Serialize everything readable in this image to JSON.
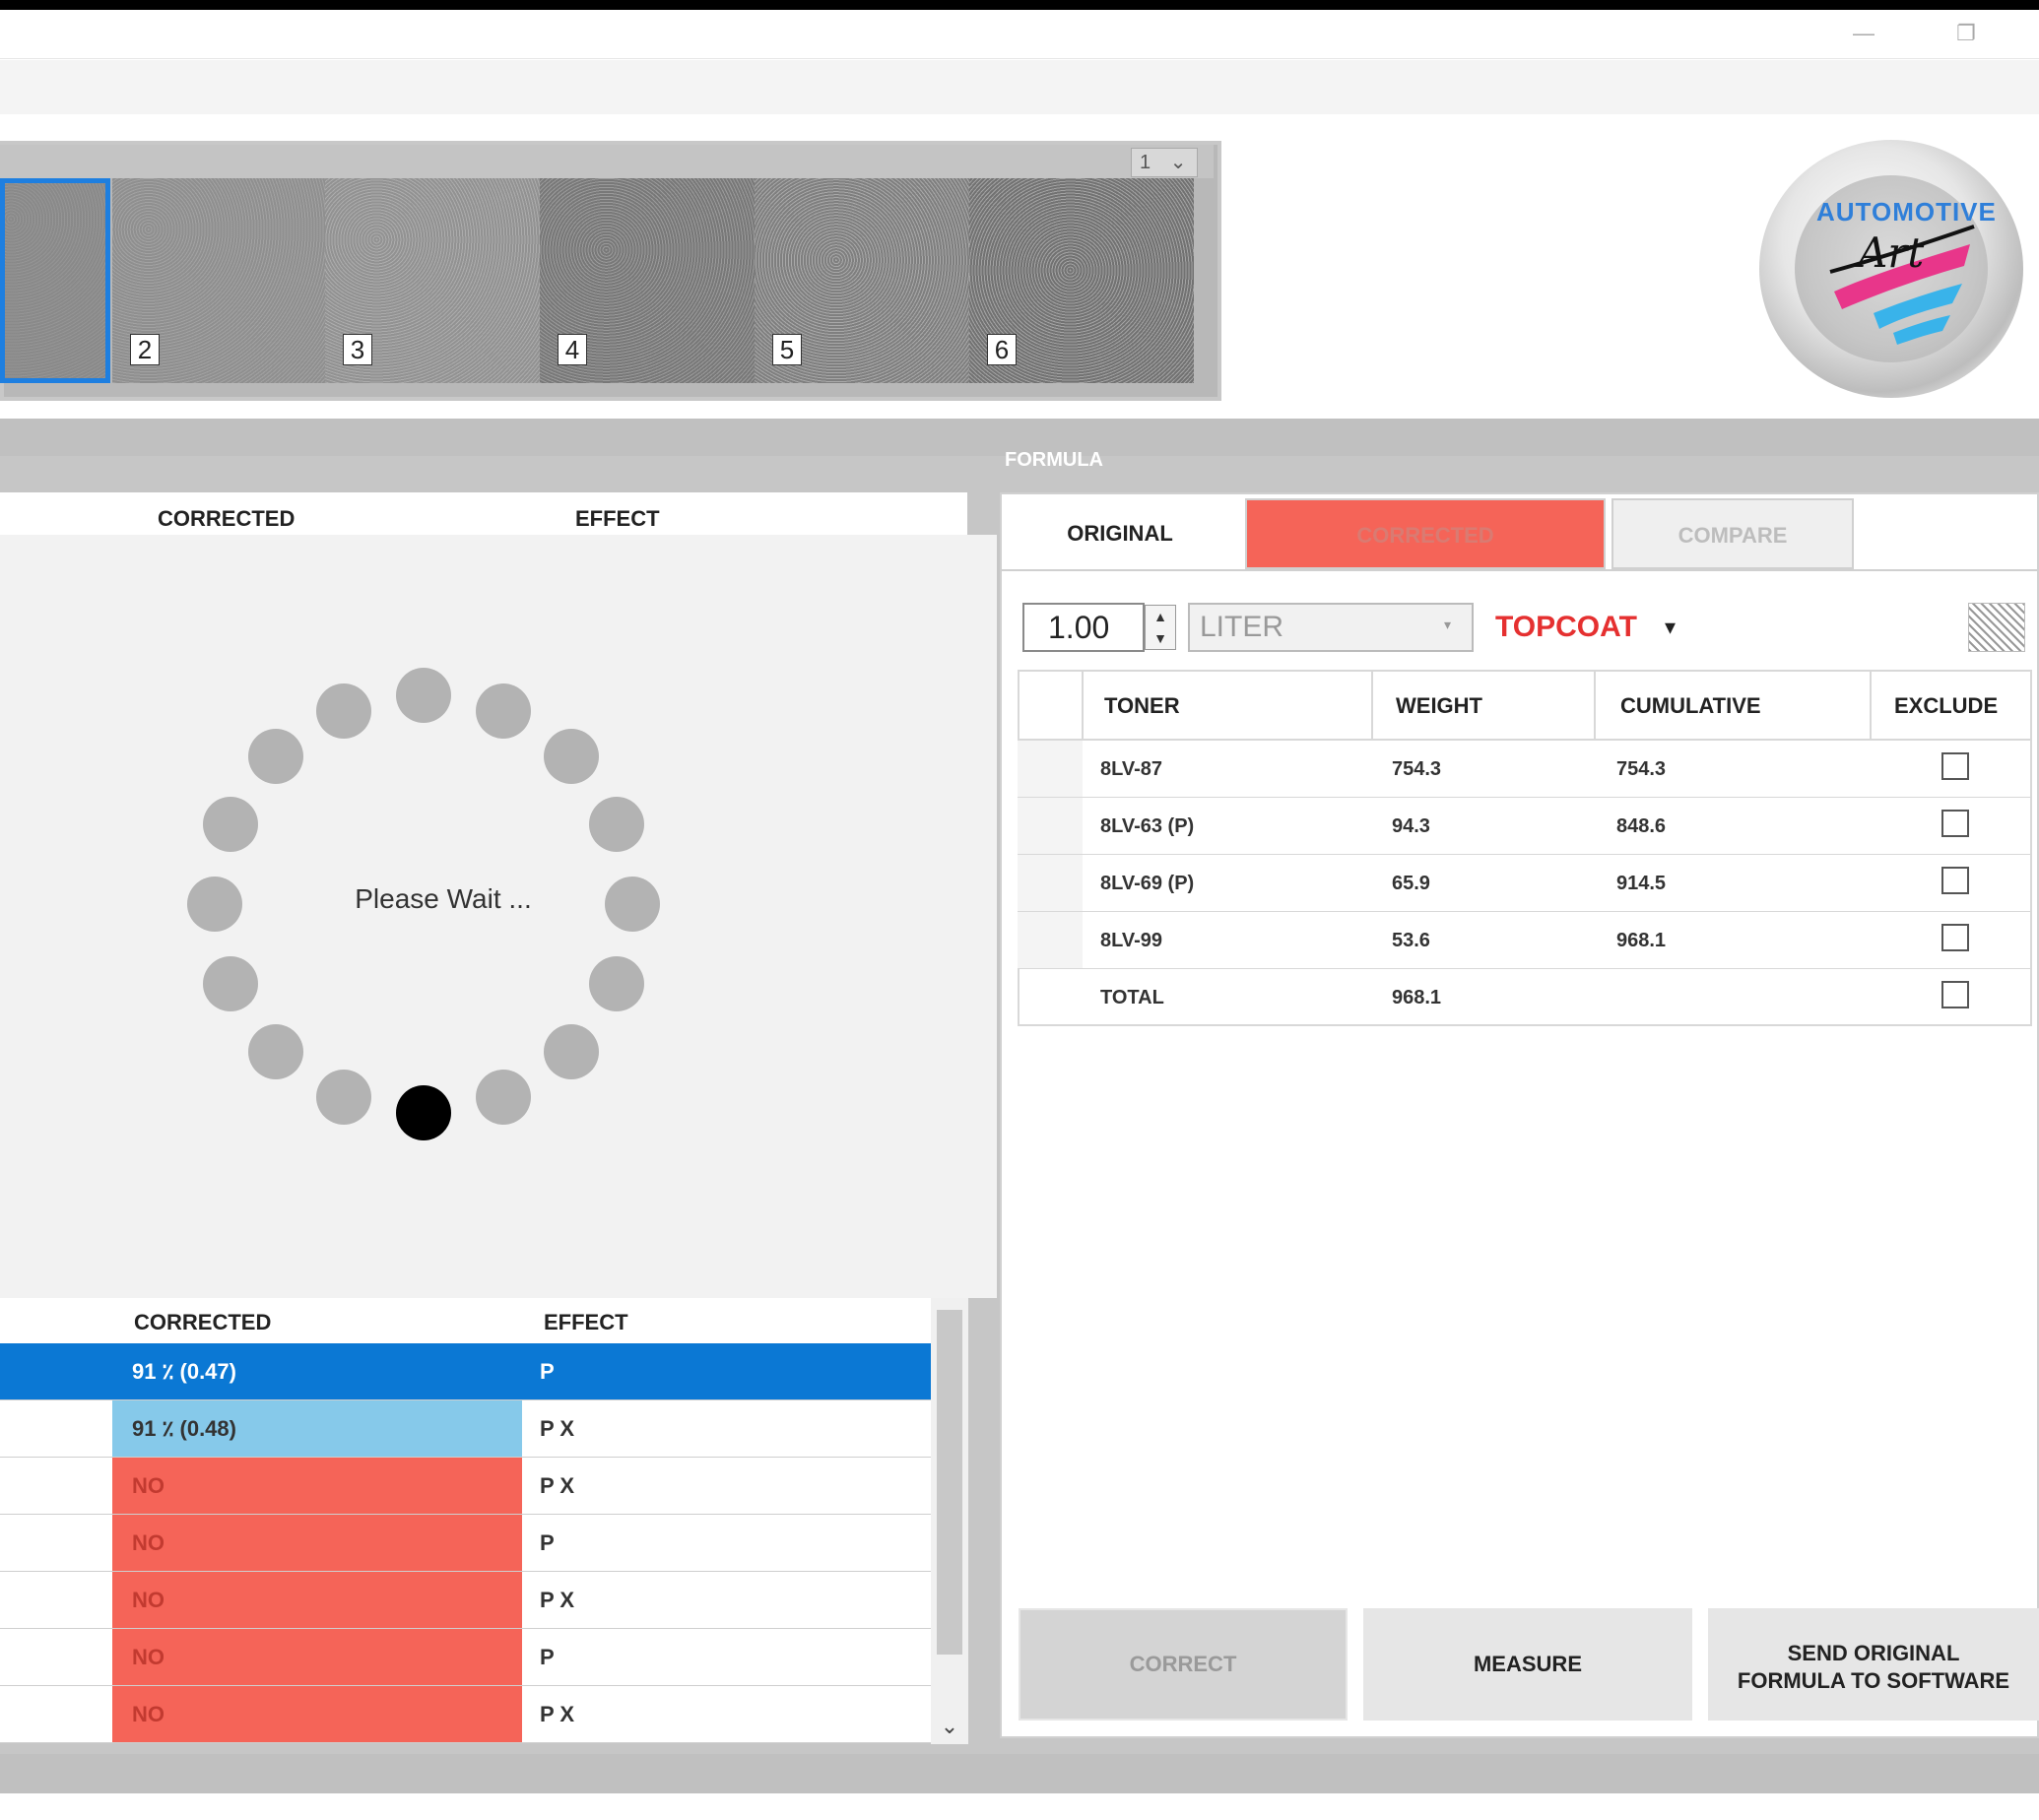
{
  "window": {
    "minimize_glyph": "—",
    "restore_glyph": "❐"
  },
  "swatches": {
    "dropdown_value": "1",
    "items": [
      {
        "label": "",
        "color": "#8f8f8f"
      },
      {
        "label": "2",
        "color": "#9a9a9a"
      },
      {
        "label": "3",
        "color": "#a2a2a2"
      },
      {
        "label": "4",
        "color": "#8a8a8a"
      },
      {
        "label": "5",
        "color": "#979797"
      },
      {
        "label": "6",
        "color": "#8c8c8c"
      }
    ]
  },
  "logo": {
    "line1": "AUTOMOTIVE",
    "line2": "Art"
  },
  "top_table": {
    "headers": [
      "CORRECTED",
      "EFFECT"
    ]
  },
  "loading": {
    "text": "Please Wait ..."
  },
  "bottom_table": {
    "headers": [
      "CORRECTED",
      "EFFECT"
    ],
    "rows": [
      {
        "corrected": "91 ٪    (0.47)",
        "effect": "P",
        "state": "selected"
      },
      {
        "corrected": "91 ٪    (0.48)",
        "effect": "P X",
        "state": "match"
      },
      {
        "corrected": "NO",
        "effect": "P X",
        "state": "no"
      },
      {
        "corrected": "NO",
        "effect": "P",
        "state": "no"
      },
      {
        "corrected": "NO",
        "effect": "P X",
        "state": "no"
      },
      {
        "corrected": "NO",
        "effect": "P",
        "state": "no"
      },
      {
        "corrected": "NO",
        "effect": "P X",
        "state": "no"
      }
    ]
  },
  "formula": {
    "title": "FORMULA",
    "tabs": {
      "original": "ORIGINAL",
      "corrected": "CORRECTED",
      "compare": "COMPARE"
    },
    "quantity": "1.00",
    "unit": "LITER",
    "layer": "TOPCOAT",
    "columns": [
      "TONER",
      "WEIGHT",
      "CUMULATIVE",
      "EXCLUDE"
    ],
    "rows": [
      {
        "toner": "8LV-87",
        "weight": "754.3",
        "cumulative": "754.3"
      },
      {
        "toner": "8LV-63 (P)",
        "weight": "94.3",
        "cumulative": "848.6"
      },
      {
        "toner": "8LV-69 (P)",
        "weight": "65.9",
        "cumulative": "914.5"
      },
      {
        "toner": "8LV-99",
        "weight": "53.6",
        "cumulative": "968.1"
      },
      {
        "toner": "TOTAL",
        "weight": "968.1",
        "cumulative": ""
      }
    ],
    "buttons": {
      "correct": "CORRECT",
      "measure": "MEASURE",
      "send_line1": "SEND ORIGINAL",
      "send_line2": "FORMULA TO SOFTWARE"
    }
  },
  "colors": {
    "selected_row": "#0b78d4",
    "match_row": "#86c9ea",
    "no_match": "#f56458",
    "topcoat": "#e53030"
  }
}
